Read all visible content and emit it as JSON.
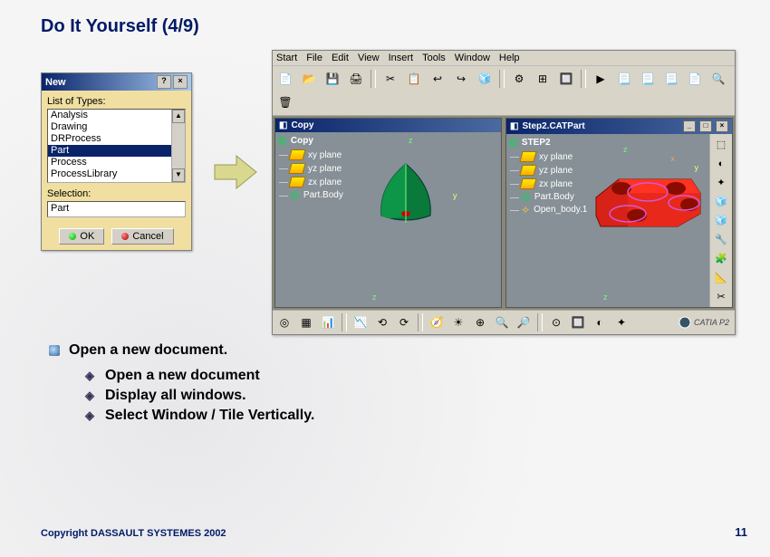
{
  "title": "Do It Yourself (4/9)",
  "dialog": {
    "title": "New",
    "help_btn": "?",
    "close_btn": "×",
    "list_label": "List of Types:",
    "types": [
      "Analysis",
      "Drawing",
      "DRProcess",
      "Part",
      "Process",
      "ProcessLibrary"
    ],
    "selected_type_index": 3,
    "selection_label": "Selection:",
    "selection_value": "Part",
    "ok_label": "OK",
    "cancel_label": "Cancel"
  },
  "app": {
    "menus": [
      "Start",
      "File",
      "Edit",
      "View",
      "Insert",
      "Tools",
      "Window",
      "Help"
    ],
    "toolbar_icons": [
      "📄",
      "📂",
      "💾",
      "🖨",
      "✂",
      "📋",
      "↩",
      "↪",
      "🧊",
      "⚙",
      "⊞",
      "🔲",
      "▶",
      "📃",
      "📃",
      "📃",
      "📄",
      "🔍",
      "🗑"
    ],
    "windows": [
      {
        "title": "Copy",
        "root": "Copy",
        "tree": [
          {
            "label": "xy plane",
            "icon": "plane"
          },
          {
            "label": "yz plane",
            "icon": "plane"
          },
          {
            "label": "zx plane",
            "icon": "plane"
          },
          {
            "label": "Part.Body",
            "icon": "gear"
          }
        ]
      },
      {
        "title": "Step2.CATPart",
        "root": "STEP2",
        "tree": [
          {
            "label": "xy plane",
            "icon": "plane"
          },
          {
            "label": "yz plane",
            "icon": "plane"
          },
          {
            "label": "zx plane",
            "icon": "plane"
          },
          {
            "label": "Part.Body",
            "icon": "gear"
          },
          {
            "label": "Open_body.1",
            "icon": "body"
          }
        ]
      }
    ],
    "axes": {
      "x": "x",
      "y": "y",
      "z": "z"
    },
    "right_toolbar": [
      "⬚",
      "◐",
      "✦",
      "🧊",
      "🧊",
      "🔧",
      "🧩",
      "📐",
      "✂"
    ],
    "bottom_toolbar": [
      "◎",
      "▦",
      "📊",
      "📉",
      "⟲",
      "⟳",
      "🧭",
      "☀",
      "⊕",
      "🔍",
      "🔎",
      "⊙",
      "🔲",
      "◐",
      "✦"
    ],
    "brand": "CATIA P2"
  },
  "instructions": {
    "main": "Open a new document.",
    "subs": [
      "Open a new document",
      "Display all windows.",
      "Select  Window / Tile Vertically."
    ]
  },
  "copyright": "Copyright DASSAULT SYSTEMES 2002",
  "page_number": "11"
}
